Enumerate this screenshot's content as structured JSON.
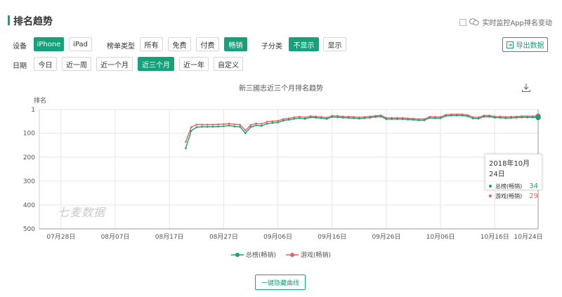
{
  "header": {
    "title": "排名趋势",
    "monitor_label": "实时监控App排名变动",
    "export_label": "导出数据"
  },
  "filters": {
    "device": {
      "label": "设备",
      "options": [
        "iPhone",
        "iPad"
      ],
      "selected": "iPhone"
    },
    "list_type": {
      "label": "榜单类型",
      "options": [
        "所有",
        "免费",
        "付费",
        "畅销"
      ],
      "selected": "畅销"
    },
    "sub_category": {
      "label": "子分类",
      "options": [
        "不显示",
        "显示"
      ],
      "selected": "不显示"
    },
    "date": {
      "label": "日期",
      "options": [
        "今日",
        "近一周",
        "近一个月",
        "近三个月",
        "近一年",
        "自定义"
      ],
      "selected": "近三个月"
    }
  },
  "watermark": "七麦数据",
  "hide_lines_label": "一键隐藏曲线",
  "tooltip": {
    "date": "2018年10月24日",
    "rows": [
      {
        "name": "总榜(畅销)",
        "value": "34",
        "color": "#13a27a"
      },
      {
        "name": "游戏(畅销)",
        "value": "29",
        "color": "#e8615c"
      }
    ]
  },
  "chart_data": {
    "type": "line",
    "title": "新三國志近三个月排名趋势",
    "ylabel": "排名",
    "y_inverted": true,
    "ylim": [
      1,
      500
    ],
    "y_ticks": [
      "1",
      "100",
      "200",
      "300",
      "400",
      "500"
    ],
    "y_tick_values": [
      1,
      100,
      200,
      300,
      400,
      500
    ],
    "x_start": "2018-07-24",
    "x_end": "2018-10-24",
    "x_ticks": [
      "07月28日",
      "08月07日",
      "08月17日",
      "08月27日",
      "09月06日",
      "09月16日",
      "09月26日",
      "10月06日",
      "10月16日",
      "10月24日"
    ],
    "x_tick_dates": [
      "2018-07-28",
      "2018-08-07",
      "2018-08-17",
      "2018-08-27",
      "2018-09-06",
      "2018-09-16",
      "2018-09-26",
      "2018-10-06",
      "2018-10-16",
      "2018-10-24"
    ],
    "grid": true,
    "legend_position": "bottom",
    "series": [
      {
        "name": "总榜(畅销)",
        "color": "#13a27a",
        "points": [
          [
            "2018-08-20",
            163
          ],
          [
            "2018-08-21",
            90
          ],
          [
            "2018-08-22",
            75
          ],
          [
            "2018-08-23",
            73
          ],
          [
            "2018-08-24",
            73
          ],
          [
            "2018-08-25",
            73
          ],
          [
            "2018-08-26",
            72
          ],
          [
            "2018-08-27",
            71
          ],
          [
            "2018-08-28",
            68
          ],
          [
            "2018-08-29",
            72
          ],
          [
            "2018-08-30",
            73
          ],
          [
            "2018-08-31",
            100
          ],
          [
            "2018-09-01",
            74
          ],
          [
            "2018-09-02",
            67
          ],
          [
            "2018-09-03",
            69
          ],
          [
            "2018-09-04",
            60
          ],
          [
            "2018-09-05",
            57
          ],
          [
            "2018-09-06",
            55
          ],
          [
            "2018-09-07",
            47
          ],
          [
            "2018-09-08",
            44
          ],
          [
            "2018-09-09",
            40
          ],
          [
            "2018-09-10",
            37
          ],
          [
            "2018-09-11",
            40
          ],
          [
            "2018-09-12",
            34
          ],
          [
            "2018-09-13",
            35
          ],
          [
            "2018-09-14",
            37
          ],
          [
            "2018-09-15",
            40
          ],
          [
            "2018-09-16",
            32
          ],
          [
            "2018-09-17",
            33
          ],
          [
            "2018-09-18",
            35
          ],
          [
            "2018-09-19",
            36
          ],
          [
            "2018-09-20",
            37
          ],
          [
            "2018-09-21",
            39
          ],
          [
            "2018-09-22",
            37
          ],
          [
            "2018-09-23",
            35
          ],
          [
            "2018-09-24",
            32
          ],
          [
            "2018-09-25",
            30
          ],
          [
            "2018-09-26",
            41
          ],
          [
            "2018-09-27",
            41
          ],
          [
            "2018-09-28",
            41
          ],
          [
            "2018-09-29",
            41
          ],
          [
            "2018-09-30",
            43
          ],
          [
            "2018-10-01",
            44
          ],
          [
            "2018-10-02",
            46
          ],
          [
            "2018-10-03",
            46
          ],
          [
            "2018-10-04",
            36
          ],
          [
            "2018-10-05",
            37
          ],
          [
            "2018-10-06",
            37
          ],
          [
            "2018-10-07",
            28
          ],
          [
            "2018-10-08",
            26
          ],
          [
            "2018-10-09",
            26
          ],
          [
            "2018-10-10",
            26
          ],
          [
            "2018-10-11",
            29
          ],
          [
            "2018-10-12",
            38
          ],
          [
            "2018-10-13",
            39
          ],
          [
            "2018-10-14",
            31
          ],
          [
            "2018-10-15",
            31
          ],
          [
            "2018-10-16",
            35
          ],
          [
            "2018-10-17",
            35
          ],
          [
            "2018-10-18",
            37
          ],
          [
            "2018-10-19",
            36
          ],
          [
            "2018-10-20",
            35
          ],
          [
            "2018-10-21",
            34
          ],
          [
            "2018-10-22",
            34
          ],
          [
            "2018-10-23",
            34
          ],
          [
            "2018-10-24",
            34
          ]
        ]
      },
      {
        "name": "游戏(畅销)",
        "color": "#e8615c",
        "points": [
          [
            "2018-08-20",
            136
          ],
          [
            "2018-08-21",
            75
          ],
          [
            "2018-08-22",
            64
          ],
          [
            "2018-08-23",
            64
          ],
          [
            "2018-08-24",
            64
          ],
          [
            "2018-08-25",
            64
          ],
          [
            "2018-08-26",
            63
          ],
          [
            "2018-08-27",
            62
          ],
          [
            "2018-08-28",
            60
          ],
          [
            "2018-08-29",
            63
          ],
          [
            "2018-08-30",
            64
          ],
          [
            "2018-08-31",
            88
          ],
          [
            "2018-09-01",
            66
          ],
          [
            "2018-09-02",
            59
          ],
          [
            "2018-09-03",
            61
          ],
          [
            "2018-09-04",
            52
          ],
          [
            "2018-09-05",
            50
          ],
          [
            "2018-09-06",
            48
          ],
          [
            "2018-09-07",
            41
          ],
          [
            "2018-09-08",
            38
          ],
          [
            "2018-09-09",
            34
          ],
          [
            "2018-09-10",
            31
          ],
          [
            "2018-09-11",
            34
          ],
          [
            "2018-09-12",
            29
          ],
          [
            "2018-09-13",
            30
          ],
          [
            "2018-09-14",
            32
          ],
          [
            "2018-09-15",
            35
          ],
          [
            "2018-09-16",
            27
          ],
          [
            "2018-09-17",
            28
          ],
          [
            "2018-09-18",
            30
          ],
          [
            "2018-09-19",
            31
          ],
          [
            "2018-09-20",
            32
          ],
          [
            "2018-09-21",
            34
          ],
          [
            "2018-09-22",
            32
          ],
          [
            "2018-09-23",
            30
          ],
          [
            "2018-09-24",
            27
          ],
          [
            "2018-09-25",
            25
          ],
          [
            "2018-09-26",
            36
          ],
          [
            "2018-09-27",
            36
          ],
          [
            "2018-09-28",
            36
          ],
          [
            "2018-09-29",
            36
          ],
          [
            "2018-09-30",
            38
          ],
          [
            "2018-10-01",
            39
          ],
          [
            "2018-10-02",
            41
          ],
          [
            "2018-10-03",
            41
          ],
          [
            "2018-10-04",
            31
          ],
          [
            "2018-10-05",
            32
          ],
          [
            "2018-10-06",
            32
          ],
          [
            "2018-10-07",
            23
          ],
          [
            "2018-10-08",
            21
          ],
          [
            "2018-10-09",
            21
          ],
          [
            "2018-10-10",
            21
          ],
          [
            "2018-10-11",
            24
          ],
          [
            "2018-10-12",
            33
          ],
          [
            "2018-10-13",
            34
          ],
          [
            "2018-10-14",
            26
          ],
          [
            "2018-10-15",
            26
          ],
          [
            "2018-10-16",
            30
          ],
          [
            "2018-10-17",
            30
          ],
          [
            "2018-10-18",
            32
          ],
          [
            "2018-10-19",
            31
          ],
          [
            "2018-10-20",
            30
          ],
          [
            "2018-10-21",
            29
          ],
          [
            "2018-10-22",
            29
          ],
          [
            "2018-10-23",
            29
          ],
          [
            "2018-10-24",
            29
          ]
        ]
      }
    ]
  }
}
